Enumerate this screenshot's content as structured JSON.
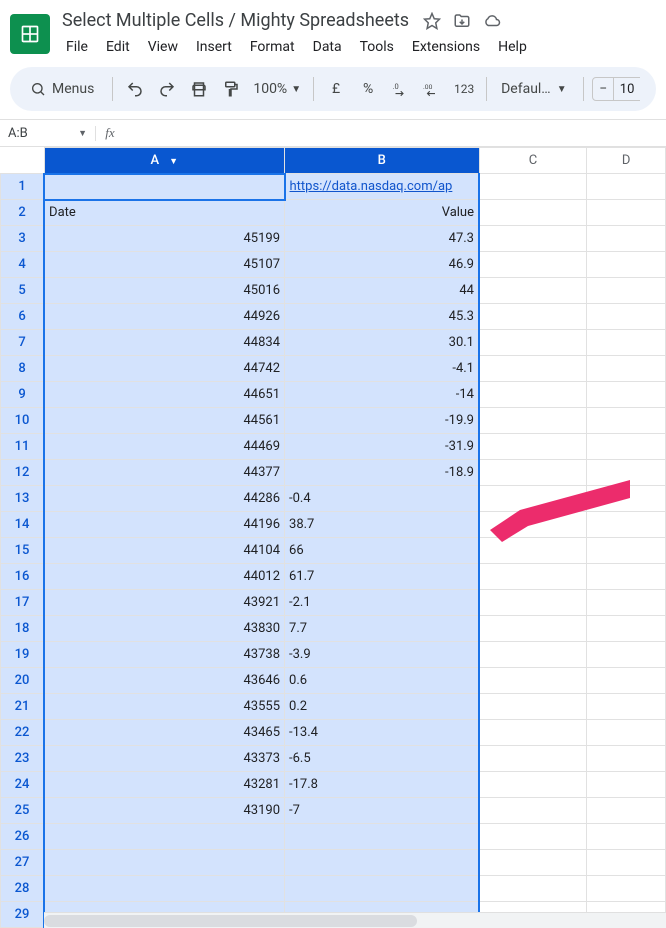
{
  "doc": {
    "title": "Select Multiple Cells / Mighty Spreadsheets"
  },
  "menus": [
    "File",
    "Edit",
    "View",
    "Insert",
    "Format",
    "Data",
    "Tools",
    "Extensions",
    "Help"
  ],
  "toolbar": {
    "menus_label": "Menus",
    "zoom": "100%",
    "currency": "£",
    "percent": "%",
    "dec_less": ".0",
    "dec_more": ".00",
    "numfmt": "123",
    "font": "Defaul…",
    "minus": "−",
    "fontsize": "10"
  },
  "namebox": "A:B",
  "columns": [
    "A",
    "B",
    "C",
    "D"
  ],
  "link_cell": "https://data.nasdaq.com/ap",
  "headers": {
    "a": "Date",
    "b": "Value"
  },
  "rows": [
    {
      "a": "45199",
      "b": "47.3",
      "balign": "right"
    },
    {
      "a": "45107",
      "b": "46.9",
      "balign": "right"
    },
    {
      "a": "45016",
      "b": "44",
      "balign": "right"
    },
    {
      "a": "44926",
      "b": "45.3",
      "balign": "right"
    },
    {
      "a": "44834",
      "b": "30.1",
      "balign": "right"
    },
    {
      "a": "44742",
      "b": "-4.1",
      "balign": "right"
    },
    {
      "a": "44651",
      "b": "-14",
      "balign": "right"
    },
    {
      "a": "44561",
      "b": "-19.9",
      "balign": "right"
    },
    {
      "a": "44469",
      "b": "-31.9",
      "balign": "right"
    },
    {
      "a": "44377",
      "b": "-18.9",
      "balign": "right"
    },
    {
      "a": "44286",
      "b": "-0.4",
      "balign": "left"
    },
    {
      "a": "44196",
      "b": "38.7",
      "balign": "left"
    },
    {
      "a": "44104",
      "b": "66",
      "balign": "left"
    },
    {
      "a": "44012",
      "b": "61.7",
      "balign": "left"
    },
    {
      "a": "43921",
      "b": "-2.1",
      "balign": "left"
    },
    {
      "a": "43830",
      "b": "7.7",
      "balign": "left"
    },
    {
      "a": "43738",
      "b": "-3.9",
      "balign": "left"
    },
    {
      "a": "43646",
      "b": "0.6",
      "balign": "left"
    },
    {
      "a": "43555",
      "b": "0.2",
      "balign": "left"
    },
    {
      "a": "43465",
      "b": "-13.4",
      "balign": "left"
    },
    {
      "a": "43373",
      "b": "-6.5",
      "balign": "left"
    },
    {
      "a": "43281",
      "b": "-17.8",
      "balign": "left"
    },
    {
      "a": "43190",
      "b": "-7",
      "balign": "left"
    }
  ],
  "total_rows": 29
}
